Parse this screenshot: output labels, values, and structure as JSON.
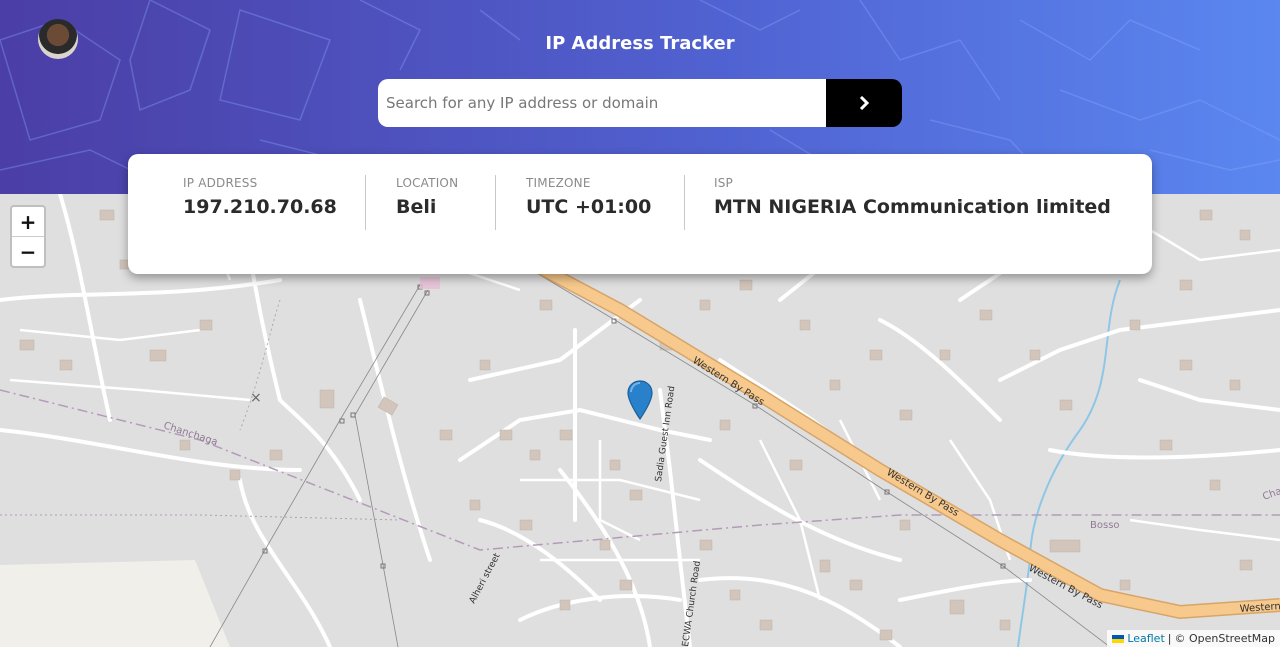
{
  "header": {
    "title": "IP Address Tracker",
    "search_placeholder": "Search for any IP address or domain",
    "search_value": ""
  },
  "info": {
    "ip": {
      "label": "IP ADDRESS",
      "value": "197.210.70.68"
    },
    "location": {
      "label": "LOCATION",
      "value": "Beli"
    },
    "timezone": {
      "label": "TIMEZONE",
      "value": "UTC +01:00"
    },
    "isp": {
      "label": "ISP",
      "value": "MTN NIGERIA Communication limited"
    }
  },
  "map": {
    "zoom_in": "+",
    "zoom_out": "−",
    "attribution": {
      "leaflet": "Leaflet",
      "separator": "|",
      "osm": "© OpenStreetMap"
    },
    "labels": {
      "road1": "Western By Pass",
      "road2": "Western By Pass",
      "road3": "Western By Pass",
      "road4": "Western",
      "road5": "Sadia Guest Inn Road",
      "road6": "ECWA Church Road",
      "road7": "Alheri street",
      "place1": "Chanchaga",
      "place2": "Bosso",
      "place3": "Cha"
    }
  },
  "colors": {
    "accent": "#000000",
    "marker": "#2a81cb",
    "highway": "#f7c98c",
    "water": "#8ec7e6"
  },
  "icons": {
    "search_button": "chevron-right-icon",
    "marker": "map-marker-icon"
  }
}
